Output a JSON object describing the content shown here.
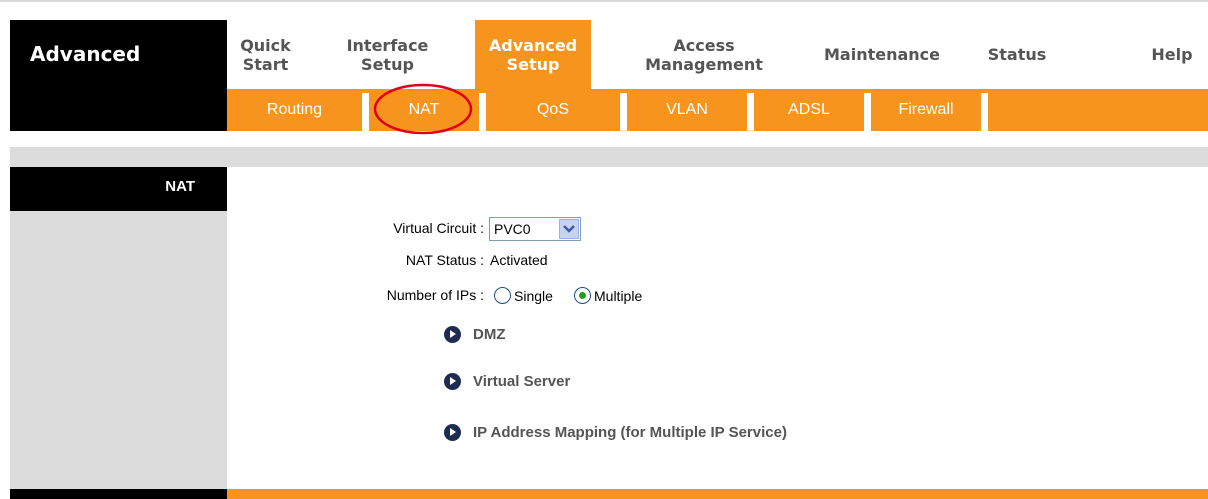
{
  "header": {
    "brand": "Advanced",
    "main_nav": [
      {
        "label": "Quick\nStart",
        "active": false
      },
      {
        "label": "Interface\nSetup",
        "active": false
      },
      {
        "label": "Advanced\nSetup",
        "active": true
      },
      {
        "label": "Access\nManagement",
        "active": false
      },
      {
        "label": "Maintenance",
        "active": false
      },
      {
        "label": "Status",
        "active": false
      },
      {
        "label": "Help",
        "active": false
      }
    ],
    "sub_nav": [
      {
        "label": "Routing"
      },
      {
        "label": "NAT",
        "active": true
      },
      {
        "label": "QoS"
      },
      {
        "label": "VLAN"
      },
      {
        "label": "ADSL"
      },
      {
        "label": "Firewall"
      }
    ]
  },
  "section": {
    "title": "NAT"
  },
  "form": {
    "virtual_circuit_label": "Virtual Circuit :",
    "virtual_circuit_value": "PVC0",
    "nat_status_label": "NAT Status :",
    "nat_status_value": "Activated",
    "number_of_ips_label": "Number of IPs :",
    "ip_options": [
      {
        "label": "Single",
        "checked": false
      },
      {
        "label": "Multiple",
        "checked": true
      }
    ]
  },
  "links": [
    {
      "label": "DMZ"
    },
    {
      "label": "Virtual Server"
    },
    {
      "label": "IP Address Mapping (for Multiple IP Service)"
    }
  ],
  "colors": {
    "accent": "#f7941d",
    "dark": "#000000",
    "panel": "#dcdcdc",
    "highlight_circle": "#e0001b"
  }
}
